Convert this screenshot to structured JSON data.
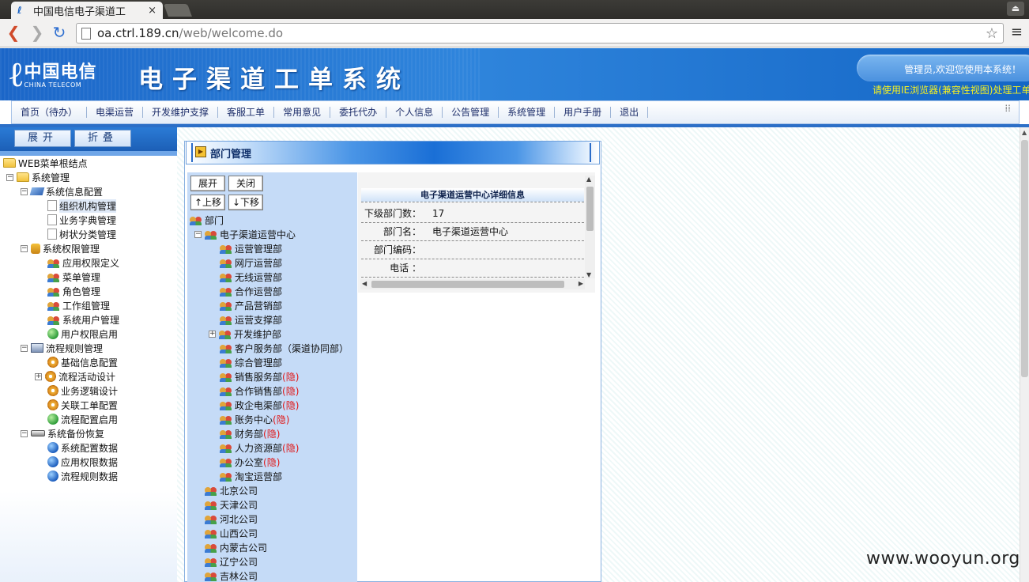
{
  "browser": {
    "tab_title": "中国电信电子渠道工",
    "tab_close": "×",
    "url_host": "oa.ctrl.189.cn",
    "url_path": "/web/welcome.do",
    "winbtn": "⏏"
  },
  "header": {
    "logo_mark": "ℓ",
    "logo_cn": "中国电信",
    "logo_en": "CHINA TELECOM",
    "system_title": "电子渠道工单系统",
    "welcome": "管理员,欢迎您使用本系统！",
    "ie_hint": "请使用IE浏览器(兼容性视图)处理工单"
  },
  "nav": {
    "items": [
      "首页（待办）",
      "电渠运营",
      "开发维护支撑",
      "客服工单",
      "常用意见",
      "委托代办",
      "个人信息",
      "公告管理",
      "系统管理",
      "用户手册",
      "退出"
    ],
    "grip": "⁞⁞"
  },
  "left_panel": {
    "expand": "展开",
    "collapse": "折叠",
    "tree": [
      {
        "label": "WEB菜单根结点",
        "icon": "folder-open-icon",
        "toggle": ""
      },
      {
        "label": "系统管理",
        "icon": "folder-open-icon",
        "toggle": "−"
      },
      {
        "label": "系统信息配置",
        "icon": "book-icon",
        "toggle": "−"
      },
      {
        "label": "组织机构管理",
        "icon": "document-icon",
        "toggle": ""
      },
      {
        "label": "业务字典管理",
        "icon": "document-icon",
        "toggle": ""
      },
      {
        "label": "树状分类管理",
        "icon": "document-icon",
        "toggle": ""
      },
      {
        "label": "系统权限管理",
        "icon": "lock-icon",
        "toggle": "−"
      },
      {
        "label": "应用权限定义",
        "icon": "users-icon",
        "toggle": ""
      },
      {
        "label": "菜单管理",
        "icon": "users-icon",
        "toggle": ""
      },
      {
        "label": "角色管理",
        "icon": "users-icon",
        "toggle": ""
      },
      {
        "label": "工作组管理",
        "icon": "users-icon",
        "toggle": ""
      },
      {
        "label": "系统用户管理",
        "icon": "users-icon",
        "toggle": ""
      },
      {
        "label": "用户权限启用",
        "icon": "globe-green-icon",
        "toggle": ""
      },
      {
        "label": "流程规则管理",
        "icon": "monitor-icon",
        "toggle": "−"
      },
      {
        "label": "基础信息配置",
        "icon": "gear-icon",
        "toggle": ""
      },
      {
        "label": "流程活动设计",
        "icon": "gear-icon",
        "toggle": "+"
      },
      {
        "label": "业务逻辑设计",
        "icon": "gear-icon",
        "toggle": ""
      },
      {
        "label": "关联工单配置",
        "icon": "gear-icon",
        "toggle": ""
      },
      {
        "label": "流程配置启用",
        "icon": "globe-green-icon",
        "toggle": ""
      },
      {
        "label": "系统备份恢复",
        "icon": "disk-icon",
        "toggle": "−"
      },
      {
        "label": "系统配置数据",
        "icon": "globe-icon",
        "toggle": ""
      },
      {
        "label": "应用权限数据",
        "icon": "globe-icon",
        "toggle": ""
      },
      {
        "label": "流程规则数据",
        "icon": "globe-icon",
        "toggle": ""
      }
    ]
  },
  "module": {
    "title": "部门管理",
    "icon_glyph": "▶"
  },
  "dept_pane": {
    "buttons": {
      "expand": "展开",
      "close": "关闭",
      "move_up": "↑上移",
      "move_down": "↓下移"
    },
    "root": "部门",
    "center": "电子渠道运营中心",
    "children": [
      {
        "name": "运营管理部",
        "hidden": ""
      },
      {
        "name": "网厅运营部",
        "hidden": ""
      },
      {
        "name": "无线运营部",
        "hidden": ""
      },
      {
        "name": "合作运营部",
        "hidden": ""
      },
      {
        "name": "产品营销部",
        "hidden": ""
      },
      {
        "name": "运营支撑部",
        "hidden": ""
      },
      {
        "name": "开发维护部",
        "hidden": ""
      },
      {
        "name": "客户服务部（渠道协同部）",
        "hidden": ""
      },
      {
        "name": "综合管理部",
        "hidden": ""
      },
      {
        "name": "销售服务部",
        "hidden": "(隐)"
      },
      {
        "name": "合作销售部",
        "hidden": "(隐)"
      },
      {
        "name": "政企电渠部",
        "hidden": "(隐)"
      },
      {
        "name": "账务中心",
        "hidden": "(隐)"
      },
      {
        "name": "财务部",
        "hidden": "(隐)"
      },
      {
        "name": "人力资源部",
        "hidden": "(隐)"
      },
      {
        "name": "办公室",
        "hidden": "(隐)"
      },
      {
        "name": "淘宝运营部",
        "hidden": ""
      }
    ],
    "companies": [
      "北京公司",
      "天津公司",
      "河北公司",
      "山西公司",
      "内蒙古公司",
      "辽宁公司",
      "吉林公司"
    ],
    "toggle_minus": "−",
    "toggle_plus": "+"
  },
  "detail": {
    "title": "电子渠道运营中心详细信息",
    "rows": [
      {
        "label": "下级部门数：",
        "value": "17"
      },
      {
        "label": "部门名：",
        "value": "电子渠道运营中心"
      },
      {
        "label": "部门编码：",
        "value": ""
      },
      {
        "label": "电话 ：",
        "value": ""
      }
    ],
    "arrows": {
      "up": "▲",
      "down": "▼",
      "left": "◀",
      "right": "▶"
    }
  },
  "watermark": "www.wooyun.org",
  "glyphs": {
    "back": "❮",
    "forward": "❯",
    "reload": "↻",
    "star": "☆",
    "menu": "≡"
  }
}
